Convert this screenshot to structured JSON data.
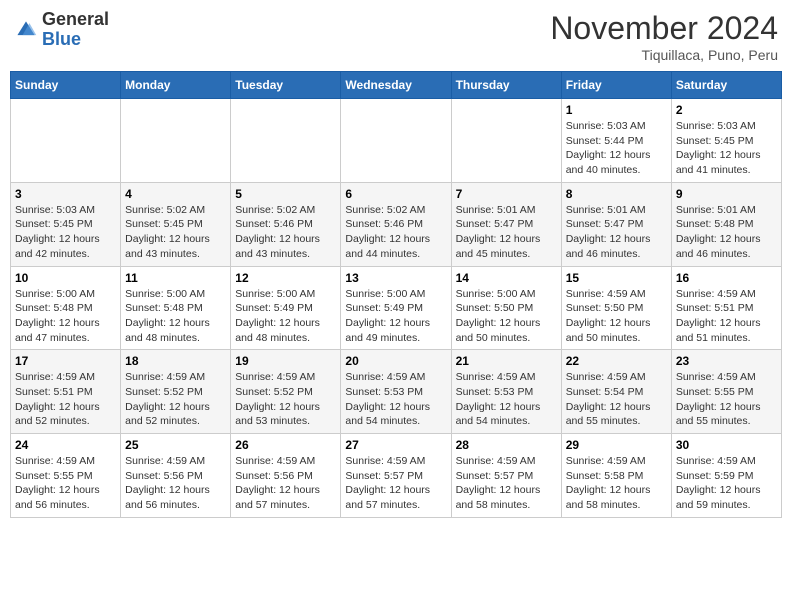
{
  "header": {
    "logo_general": "General",
    "logo_blue": "Blue",
    "month": "November 2024",
    "location": "Tiquillaca, Puno, Peru"
  },
  "days_of_week": [
    "Sunday",
    "Monday",
    "Tuesday",
    "Wednesday",
    "Thursday",
    "Friday",
    "Saturday"
  ],
  "weeks": [
    [
      {
        "day": "",
        "info": ""
      },
      {
        "day": "",
        "info": ""
      },
      {
        "day": "",
        "info": ""
      },
      {
        "day": "",
        "info": ""
      },
      {
        "day": "",
        "info": ""
      },
      {
        "day": "1",
        "info": "Sunrise: 5:03 AM\nSunset: 5:44 PM\nDaylight: 12 hours\nand 40 minutes."
      },
      {
        "day": "2",
        "info": "Sunrise: 5:03 AM\nSunset: 5:45 PM\nDaylight: 12 hours\nand 41 minutes."
      }
    ],
    [
      {
        "day": "3",
        "info": "Sunrise: 5:03 AM\nSunset: 5:45 PM\nDaylight: 12 hours\nand 42 minutes."
      },
      {
        "day": "4",
        "info": "Sunrise: 5:02 AM\nSunset: 5:45 PM\nDaylight: 12 hours\nand 43 minutes."
      },
      {
        "day": "5",
        "info": "Sunrise: 5:02 AM\nSunset: 5:46 PM\nDaylight: 12 hours\nand 43 minutes."
      },
      {
        "day": "6",
        "info": "Sunrise: 5:02 AM\nSunset: 5:46 PM\nDaylight: 12 hours\nand 44 minutes."
      },
      {
        "day": "7",
        "info": "Sunrise: 5:01 AM\nSunset: 5:47 PM\nDaylight: 12 hours\nand 45 minutes."
      },
      {
        "day": "8",
        "info": "Sunrise: 5:01 AM\nSunset: 5:47 PM\nDaylight: 12 hours\nand 46 minutes."
      },
      {
        "day": "9",
        "info": "Sunrise: 5:01 AM\nSunset: 5:48 PM\nDaylight: 12 hours\nand 46 minutes."
      }
    ],
    [
      {
        "day": "10",
        "info": "Sunrise: 5:00 AM\nSunset: 5:48 PM\nDaylight: 12 hours\nand 47 minutes."
      },
      {
        "day": "11",
        "info": "Sunrise: 5:00 AM\nSunset: 5:48 PM\nDaylight: 12 hours\nand 48 minutes."
      },
      {
        "day": "12",
        "info": "Sunrise: 5:00 AM\nSunset: 5:49 PM\nDaylight: 12 hours\nand 48 minutes."
      },
      {
        "day": "13",
        "info": "Sunrise: 5:00 AM\nSunset: 5:49 PM\nDaylight: 12 hours\nand 49 minutes."
      },
      {
        "day": "14",
        "info": "Sunrise: 5:00 AM\nSunset: 5:50 PM\nDaylight: 12 hours\nand 50 minutes."
      },
      {
        "day": "15",
        "info": "Sunrise: 4:59 AM\nSunset: 5:50 PM\nDaylight: 12 hours\nand 50 minutes."
      },
      {
        "day": "16",
        "info": "Sunrise: 4:59 AM\nSunset: 5:51 PM\nDaylight: 12 hours\nand 51 minutes."
      }
    ],
    [
      {
        "day": "17",
        "info": "Sunrise: 4:59 AM\nSunset: 5:51 PM\nDaylight: 12 hours\nand 52 minutes."
      },
      {
        "day": "18",
        "info": "Sunrise: 4:59 AM\nSunset: 5:52 PM\nDaylight: 12 hours\nand 52 minutes."
      },
      {
        "day": "19",
        "info": "Sunrise: 4:59 AM\nSunset: 5:52 PM\nDaylight: 12 hours\nand 53 minutes."
      },
      {
        "day": "20",
        "info": "Sunrise: 4:59 AM\nSunset: 5:53 PM\nDaylight: 12 hours\nand 54 minutes."
      },
      {
        "day": "21",
        "info": "Sunrise: 4:59 AM\nSunset: 5:53 PM\nDaylight: 12 hours\nand 54 minutes."
      },
      {
        "day": "22",
        "info": "Sunrise: 4:59 AM\nSunset: 5:54 PM\nDaylight: 12 hours\nand 55 minutes."
      },
      {
        "day": "23",
        "info": "Sunrise: 4:59 AM\nSunset: 5:55 PM\nDaylight: 12 hours\nand 55 minutes."
      }
    ],
    [
      {
        "day": "24",
        "info": "Sunrise: 4:59 AM\nSunset: 5:55 PM\nDaylight: 12 hours\nand 56 minutes."
      },
      {
        "day": "25",
        "info": "Sunrise: 4:59 AM\nSunset: 5:56 PM\nDaylight: 12 hours\nand 56 minutes."
      },
      {
        "day": "26",
        "info": "Sunrise: 4:59 AM\nSunset: 5:56 PM\nDaylight: 12 hours\nand 57 minutes."
      },
      {
        "day": "27",
        "info": "Sunrise: 4:59 AM\nSunset: 5:57 PM\nDaylight: 12 hours\nand 57 minutes."
      },
      {
        "day": "28",
        "info": "Sunrise: 4:59 AM\nSunset: 5:57 PM\nDaylight: 12 hours\nand 58 minutes."
      },
      {
        "day": "29",
        "info": "Sunrise: 4:59 AM\nSunset: 5:58 PM\nDaylight: 12 hours\nand 58 minutes."
      },
      {
        "day": "30",
        "info": "Sunrise: 4:59 AM\nSunset: 5:59 PM\nDaylight: 12 hours\nand 59 minutes."
      }
    ]
  ]
}
